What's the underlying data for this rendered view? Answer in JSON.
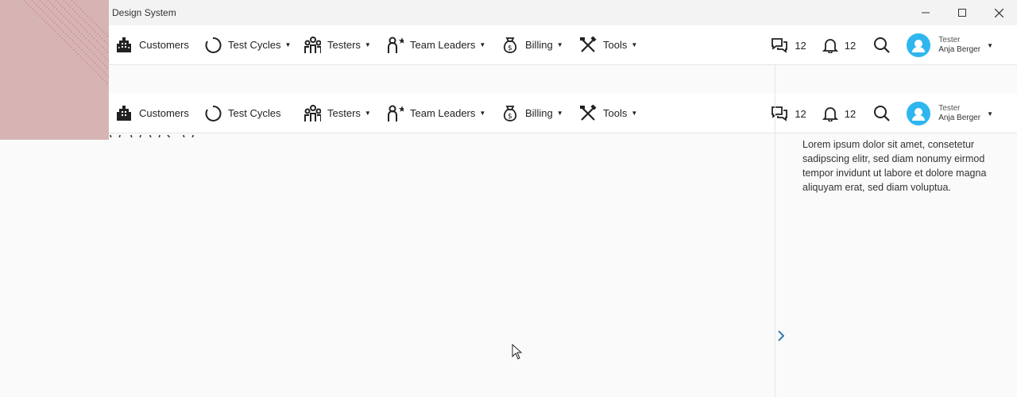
{
  "window": {
    "title": "Design System"
  },
  "nav": {
    "items": [
      {
        "label": "Customers",
        "icon": "building-icon",
        "has_caret": false
      },
      {
        "label": "Test Cycles",
        "icon": "cycle-icon",
        "has_caret": true
      },
      {
        "label": "Testers",
        "icon": "testers-icon",
        "has_caret": true
      },
      {
        "label": "Team Leaders",
        "icon": "team-leader-icon",
        "has_caret": true
      },
      {
        "label": "Billing",
        "icon": "money-bag-icon",
        "has_caret": true
      },
      {
        "label": "Tools",
        "icon": "tools-icon",
        "has_caret": true
      }
    ],
    "messages_count": "12",
    "notifications_count": "12",
    "user_role": "Tester",
    "user_name": "Anja Berger"
  },
  "nav_second": {
    "messages_count": "12",
    "notifications_count": "12",
    "user_role": "Tester",
    "user_name": "Anja Berger"
  },
  "side_panel": {
    "text": "Lorem ipsum dolor sit amet, consetetur sadipscing elitr, sed diam nonumy eirmod tempor invidunt ut labore et dolore magna aliquyam erat, sed diam voluptua."
  },
  "colors": {
    "accent": "#2fb6ef",
    "corner": "#d6b4b4",
    "chevron": "#1a6fa8"
  }
}
